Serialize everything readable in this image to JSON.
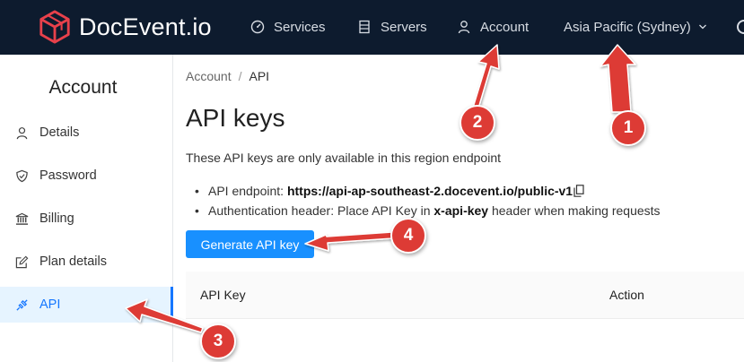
{
  "header": {
    "brand": "DocEvent.io",
    "nav": {
      "services": "Services",
      "servers": "Servers",
      "account": "Account",
      "region": "Asia Pacific (Sydney)"
    }
  },
  "sidebar": {
    "title": "Account",
    "items": [
      {
        "label": "Details",
        "icon": "user-icon"
      },
      {
        "label": "Password",
        "icon": "shield-icon"
      },
      {
        "label": "Billing",
        "icon": "bank-icon"
      },
      {
        "label": "Plan details",
        "icon": "edit-icon"
      },
      {
        "label": "API",
        "icon": "api-icon",
        "active": true
      }
    ]
  },
  "breadcrumb": {
    "parent": "Account",
    "separator": "/",
    "current": "API"
  },
  "main": {
    "title": "API keys",
    "intro": "These API keys are only available in this region endpoint",
    "endpoint_prefix": "API endpoint: ",
    "endpoint_url": "https://api-ap-southeast-2.docevent.io/public-v1",
    "auth_prefix": "Authentication header: Place API Key in ",
    "auth_header": "x-api-key",
    "auth_suffix": " header when making requests",
    "generate_button": "Generate API key",
    "table": {
      "columns": [
        "API Key",
        "Action"
      ]
    }
  },
  "annotations": {
    "badges": [
      "1",
      "2",
      "3",
      "4"
    ],
    "color": "#dd3b35"
  },
  "colors": {
    "topbar": "#0d1b2e",
    "accent": "#1890ff",
    "active_bg": "#e6f4ff",
    "logo": "#e8414b"
  }
}
